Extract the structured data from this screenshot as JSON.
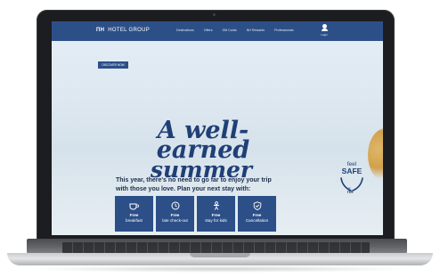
{
  "nav": {
    "logo_mark": "ΠH",
    "logo_text": "HOTEL GROUP",
    "links": [
      "Destinations",
      "Offers",
      "Gift Cards",
      "NH Rewards",
      "Professionals"
    ],
    "user_label": "Login"
  },
  "hero": {
    "discover_button": "DISCOVER NOW",
    "headline_line1": "A well-earned",
    "headline_line2": "summer",
    "subtext_line1": "This year, there's no need to go far to enjoy your trip",
    "subtext_line2": "with those you love. Plan your next stay with:",
    "tiles": [
      {
        "icon": "coffee-cup-icon",
        "title": "Free",
        "subtitle": "breakfast"
      },
      {
        "icon": "clock-icon",
        "title": "Free",
        "subtitle": "late check-out"
      },
      {
        "icon": "child-icon",
        "title": "Free",
        "subtitle": "stay for kids"
      },
      {
        "icon": "shield-check-icon",
        "title": "Free",
        "subtitle": "Cancellation"
      }
    ]
  },
  "badge": {
    "feel": "feel",
    "safe": "SAFE",
    "at": "at",
    "brand": "ΠH"
  },
  "colors": {
    "brand_blue": "#2d4f88",
    "headline_blue": "#1f3f76",
    "laptop_frame": "#1c1d20"
  }
}
